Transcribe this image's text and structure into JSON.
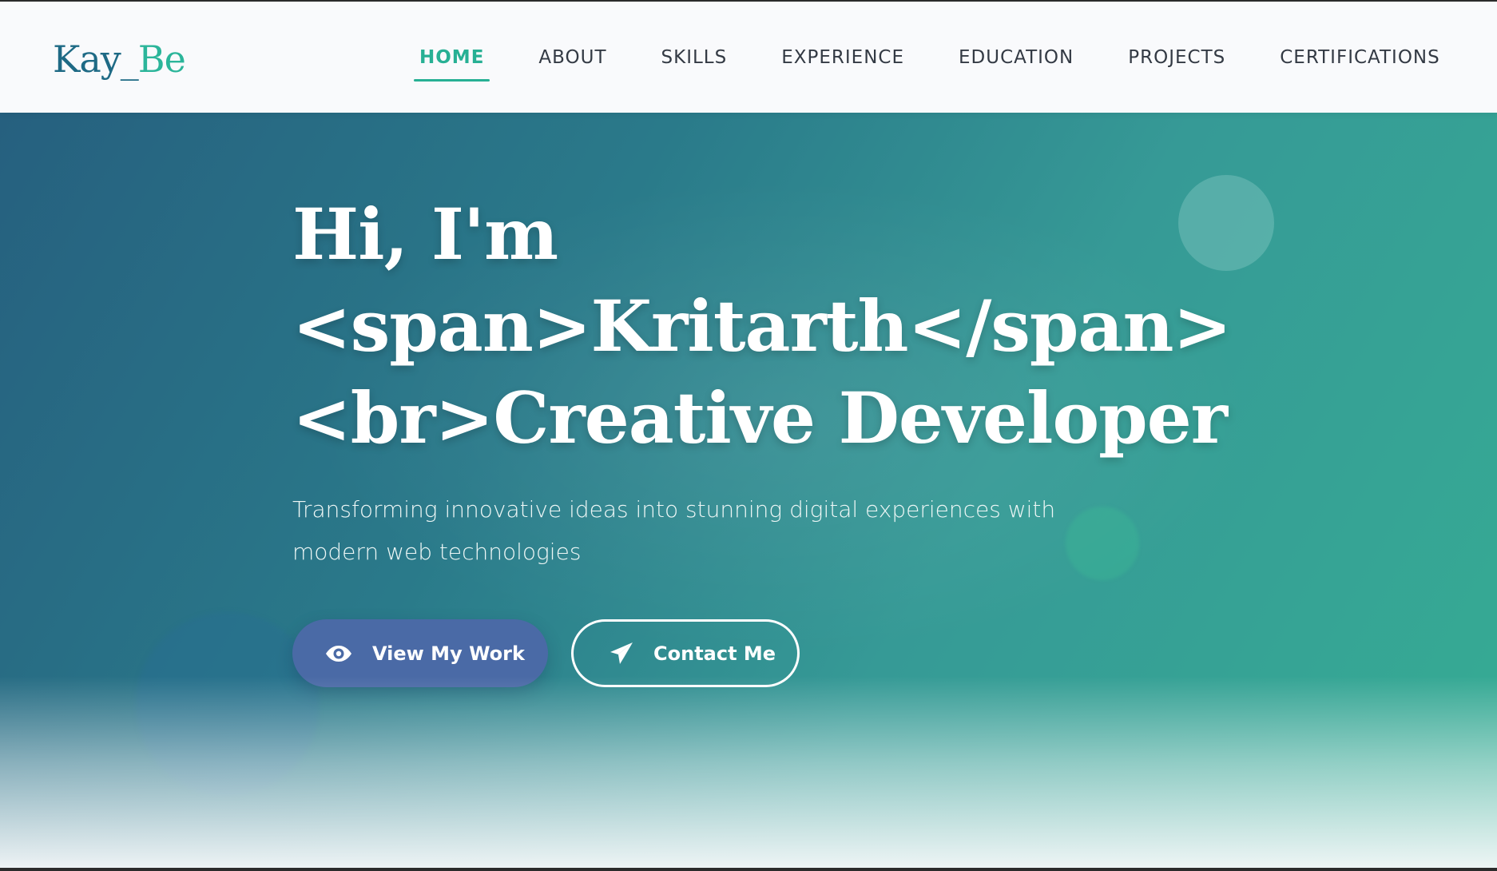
{
  "brand": {
    "logo_part1": "Kay_",
    "logo_part2": "Be",
    "color_primary": "#1e6a85",
    "color_accent": "#2bb59a"
  },
  "nav": {
    "items": [
      {
        "label": "HOME",
        "active": true
      },
      {
        "label": "ABOUT"
      },
      {
        "label": "SKILLS"
      },
      {
        "label": "EXPERIENCE"
      },
      {
        "label": "EDUCATION"
      },
      {
        "label": "PROJECTS"
      },
      {
        "label": "CERTIFICATIONS"
      }
    ]
  },
  "hero": {
    "title_line1": "Hi, I'm",
    "title_line2": "<span>Kritarth</span>",
    "title_line3": "<br>Creative Developer",
    "subtitle": "Transforming innovative ideas into stunning digital experiences with modern web technologies",
    "primary_button": {
      "label": "View My Work",
      "icon": "eye-icon"
    },
    "secondary_button": {
      "label": "Contact Me",
      "icon": "paper-plane-icon"
    },
    "gradient_start": "#26607f",
    "gradient_end": "#36ac94"
  }
}
